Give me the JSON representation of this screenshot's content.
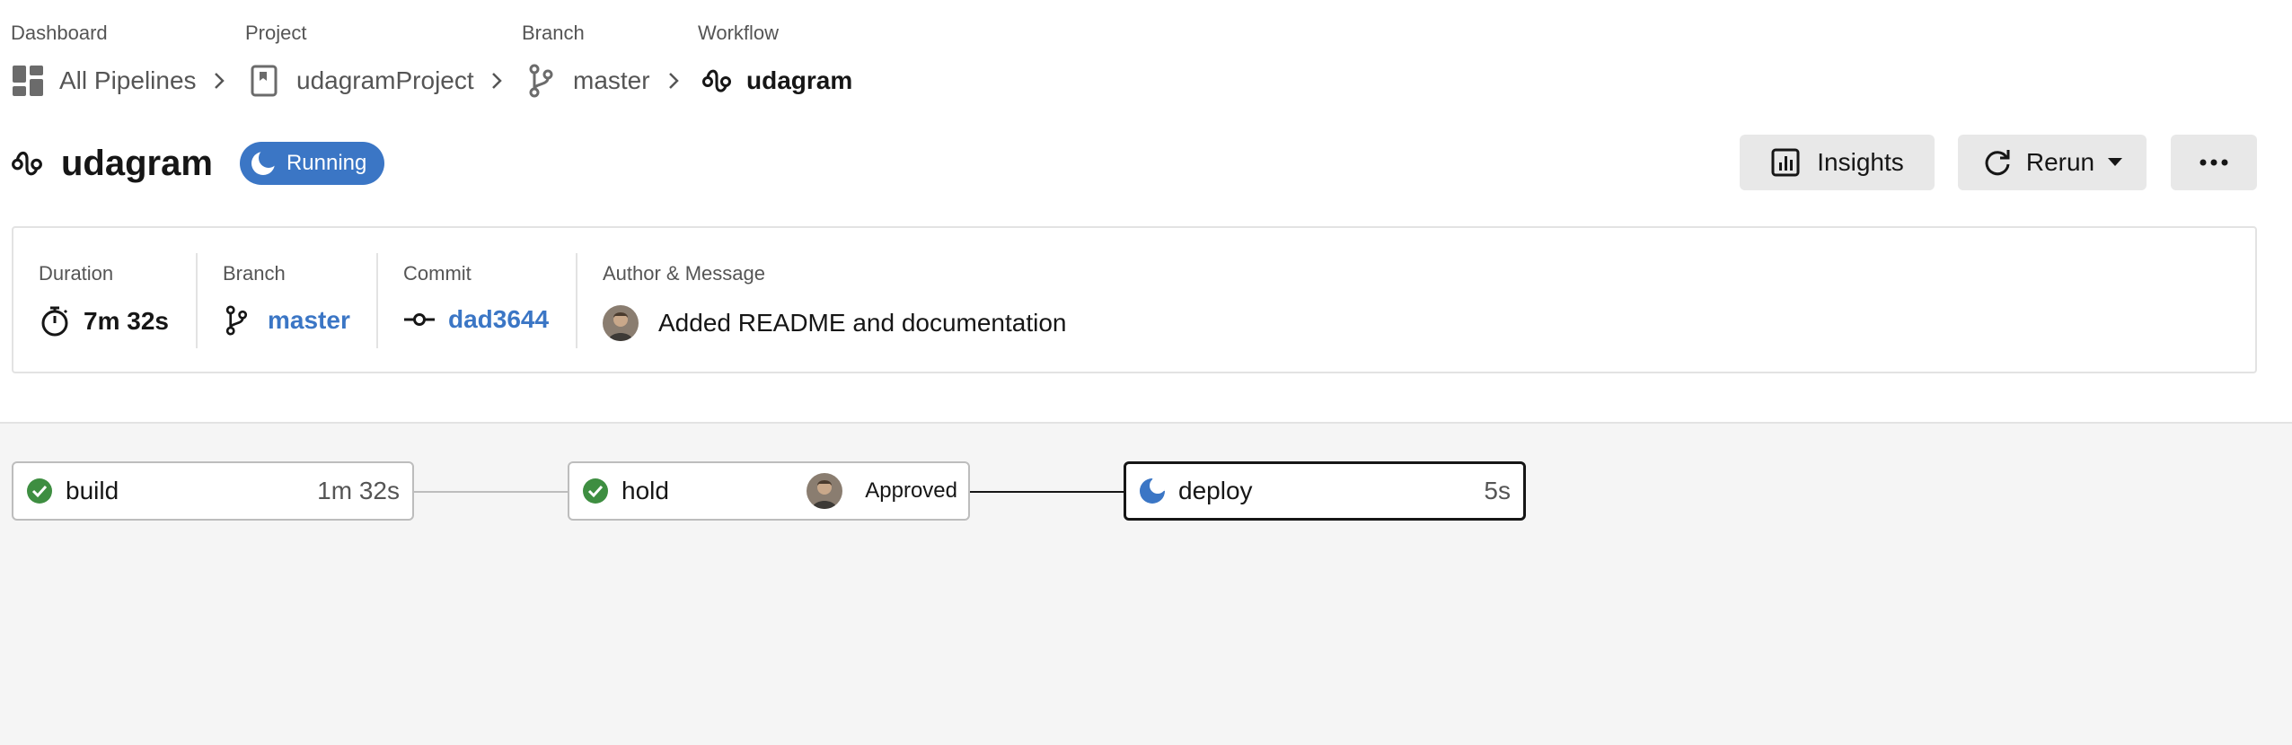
{
  "breadcrumb": {
    "dashboard": {
      "label": "Dashboard",
      "link": "All Pipelines"
    },
    "project": {
      "label": "Project",
      "link": "udagramProject"
    },
    "branch": {
      "label": "Branch",
      "link": "master"
    },
    "workflow": {
      "label": "Workflow",
      "current": "udagram"
    }
  },
  "header": {
    "title": "udagram",
    "status": "Running",
    "status_color": "#3b76c5",
    "buttons": {
      "insights": "Insights",
      "rerun": "Rerun",
      "more": "..."
    }
  },
  "info": {
    "duration": {
      "label": "Duration",
      "value": "7m 32s"
    },
    "branch": {
      "label": "Branch",
      "value": "master"
    },
    "commit": {
      "label": "Commit",
      "value": "dad3644"
    },
    "author": {
      "label": "Author & Message",
      "message": "Added README and documentation"
    }
  },
  "jobs": [
    {
      "name": "build",
      "time": "1m 32s",
      "status": "success"
    },
    {
      "name": "hold",
      "status": "success",
      "approval": "Approved"
    },
    {
      "name": "deploy",
      "time": "5s",
      "status": "running"
    }
  ],
  "colors": {
    "success": "#3e8e41",
    "accent": "#3b76c5",
    "text": "#161616",
    "muted": "#555555"
  }
}
